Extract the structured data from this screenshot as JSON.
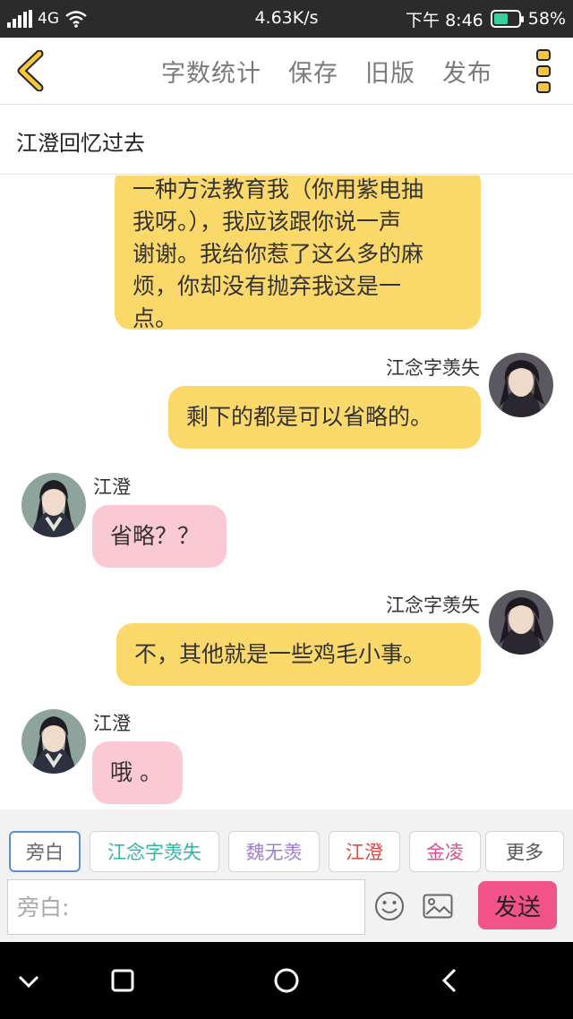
{
  "status_bar": {
    "network_sim": "2",
    "network_type": "4G",
    "speed": "4.63K/s",
    "time": "下午 8:46",
    "battery": "58%",
    "battery_level": 0.58
  },
  "toolbar": {
    "back_icon": "chevron-left-icon",
    "items": [
      "字数统计",
      "保存",
      "旧版",
      "发布"
    ],
    "more_icon": "more-vertical-icon",
    "accent_color": "#f5c83c"
  },
  "story_title": "江澄回忆过去",
  "messages": [
    {
      "side": "right",
      "color": "yellow",
      "lines": [
        "一种方法教育我（你用紫电抽",
        "我呀。），我应该跟你说一声",
        "谢谢。我给你惹了这么多的麻",
        "烦，你却没有抛弃我这是一",
        "点。"
      ]
    },
    {
      "side": "right",
      "sender": "江念字羡失",
      "color": "yellow",
      "text": "剩下的都是可以省略的。"
    },
    {
      "side": "left",
      "sender": "江澄",
      "color": "pink",
      "text": "省略？？"
    },
    {
      "side": "right",
      "sender": "江念字羡失",
      "color": "yellow",
      "text": "不，其他就是一些鸡毛小事。"
    },
    {
      "side": "left",
      "sender": "江澄",
      "color": "pink",
      "text": "哦 。"
    }
  ],
  "roles": [
    {
      "label": "旁白",
      "color": "#666666",
      "active": true
    },
    {
      "label": "江念字羡失",
      "color": "#2fb5a6"
    },
    {
      "label": "魏无羡",
      "color": "#a07fd0"
    },
    {
      "label": "江澄",
      "color": "#e04848"
    },
    {
      "label": "金凌",
      "color": "#e0508f"
    },
    {
      "label": "更多",
      "color": "#555555"
    }
  ],
  "input": {
    "placeholder": "旁白:",
    "emoji_icon": "smiley-icon",
    "image_icon": "image-icon",
    "send_label": "发送"
  },
  "nav": [
    "chevron-down-icon",
    "square-icon",
    "circle-icon",
    "back-triangle-icon"
  ]
}
